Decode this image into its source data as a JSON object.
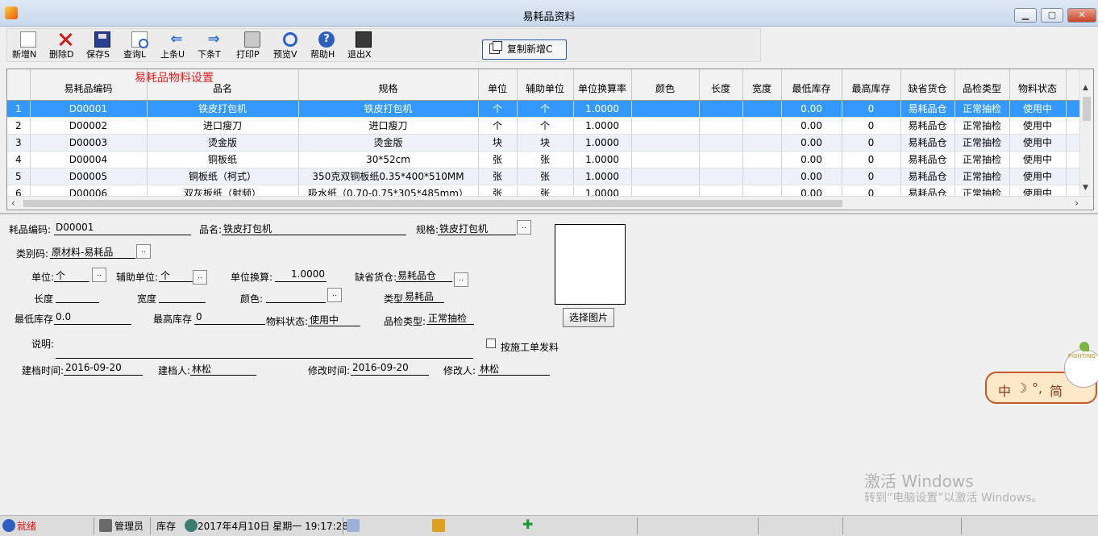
{
  "window": {
    "title": "易耗品资料"
  },
  "toolbar": {
    "buttons": [
      {
        "label": "新增N",
        "icon": "new-doc-icon"
      },
      {
        "label": "删除D",
        "icon": "delete-x-icon"
      },
      {
        "label": "保存S",
        "icon": "floppy-disk-icon"
      },
      {
        "label": "查询L",
        "icon": "find-document-icon"
      },
      {
        "label": "上条U",
        "icon": "arrow-left-icon"
      },
      {
        "label": "下条T",
        "icon": "arrow-right-icon"
      },
      {
        "label": "打印P",
        "icon": "printer-icon"
      },
      {
        "label": "预览V",
        "icon": "magnifier-icon"
      },
      {
        "label": "帮助H",
        "icon": "help-icon"
      },
      {
        "label": "退出X",
        "icon": "exit-door-icon"
      }
    ],
    "copy_label": "复制新增C"
  },
  "grid": {
    "caption": "易耗品物料设置",
    "columns": [
      "",
      "易耗品编码",
      "品名",
      "规格",
      "单位",
      "辅助单位",
      "单位换算率",
      "颜色",
      "长度",
      "宽度",
      "最低库存",
      "最高库存",
      "缺省货仓",
      "品检类型",
      "物料状态"
    ],
    "rows": [
      [
        "1",
        "D00001",
        "铁皮打包机",
        "铁皮打包机",
        "个",
        "个",
        "1.0000",
        "",
        "",
        "",
        "0.00",
        "0",
        "易耗品仓",
        "正常抽检",
        "使用中"
      ],
      [
        "2",
        "D00002",
        "进口瘦刀",
        "进口瘦刀",
        "个",
        "个",
        "1.0000",
        "",
        "",
        "",
        "0.00",
        "0",
        "易耗品仓",
        "正常抽检",
        "使用中"
      ],
      [
        "3",
        "D00003",
        "烫金版",
        "烫金版",
        "块",
        "块",
        "1.0000",
        "",
        "",
        "",
        "0.00",
        "0",
        "易耗品仓",
        "正常抽检",
        "使用中"
      ],
      [
        "4",
        "D00004",
        "铜板纸",
        "30*52cm",
        "张",
        "张",
        "1.0000",
        "",
        "",
        "",
        "0.00",
        "0",
        "易耗品仓",
        "正常抽检",
        "使用中"
      ],
      [
        "5",
        "D00005",
        "铜板纸（柯式）",
        "350克双铜板纸0.35*400*510MM",
        "张",
        "张",
        "1.0000",
        "",
        "",
        "",
        "0.00",
        "0",
        "易耗品仓",
        "正常抽检",
        "使用中"
      ],
      [
        "6",
        "D00006",
        "双灰板纸（射频）",
        "吸水纸（0.70-0.75*305*485mm）",
        "张",
        "张",
        "1.0000",
        "",
        "",
        "",
        "0.00",
        "0",
        "易耗品仓",
        "正常抽检",
        "使用中"
      ]
    ]
  },
  "form": {
    "code_label": "耗品编码:",
    "code_value": "D00001",
    "name_label": "品名:",
    "name_value": "铁皮打包机",
    "spec_label": "规格:",
    "spec_value": "铁皮打包机",
    "category_label": "类别码:",
    "category_value": "原材料-易耗品",
    "unit_label": "单位:",
    "unit_value": "个",
    "aux_unit_label": "辅助单位:",
    "aux_unit_value": "个",
    "conversion_label": "单位换算:",
    "conversion_value": "1.0000",
    "warehouse_label": "缺省货仓:",
    "warehouse_value": "易耗品仓",
    "length_label": "长度",
    "length_value": "",
    "width_label": "宽度",
    "width_value": "",
    "color_label": "颜色:",
    "color_value": "",
    "type_label": "类型",
    "type_value": "易耗品",
    "min_stock_label": "最低库存",
    "min_stock_value": "0.0",
    "max_stock_label": "最高库存",
    "max_stock_value": "0",
    "material_status_label": "物料状态:",
    "material_status_value": "使用中",
    "qc_type_label": "品检类型:",
    "qc_type_value": "正常抽检",
    "remark_label": "说明:",
    "remark_value": "",
    "checkbox_label": "按施工单发料",
    "checkbox_checked": false,
    "created_time_label": "建档时间:",
    "created_time_value": "2016-09-20",
    "creator_label": "建档人:",
    "creator_value": "林松",
    "modified_time_label": "修改时间:",
    "modified_time_value": "2016-09-20",
    "modifier_label": "修改人:",
    "modifier_value": "林松",
    "picture_button": "选择图片",
    "browse_button": ".."
  },
  "ime": {
    "chars": [
      "中",
      "☽",
      "°,",
      "简"
    ],
    "badge": "FIGHTING"
  },
  "watermark": {
    "line1": "激活 Windows",
    "line2": "转到“电脑设置”以激活 Windows。"
  },
  "statusbar": {
    "status": "就绪",
    "user": "管理员",
    "module": "库存",
    "datetime": "2017年4月10日  星期一  19:17:28"
  },
  "colors": {
    "selection": "#3399ff",
    "title_bar": "#c8d8ec",
    "caption_red": "#e02020"
  }
}
